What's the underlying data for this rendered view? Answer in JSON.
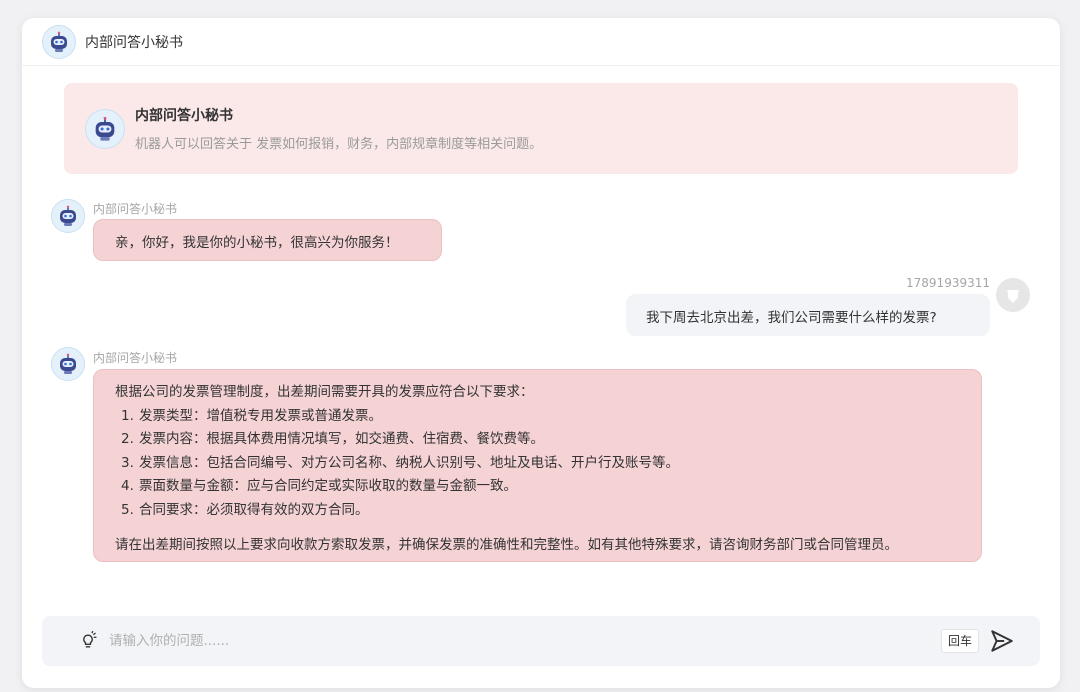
{
  "header": {
    "title": "内部问答小秘书",
    "avatar_icon": "robot-icon"
  },
  "intro": {
    "name": "内部问答小秘书",
    "description": "机器人可以回答关于 发票如何报销，财务，内部规章制度等相关问题。",
    "background": "#fbe9ea"
  },
  "messages": {
    "bot_greeting": {
      "sender": "内部问答小秘书",
      "text": "亲，你好，我是你的小秘书，很高兴为你服务！"
    },
    "user_question": {
      "sender": "17891939311",
      "text": "我下周去北京出差，我们公司需要什么样的发票?"
    },
    "bot_answer": {
      "sender": "内部问答小秘书",
      "intro": "根据公司的发票管理制度，出差期间需要开具的发票应符合以下要求：",
      "items": [
        {
          "num": "1.",
          "text": "发票类型：增值税专用发票或普通发票。"
        },
        {
          "num": "2.",
          "text": "发票内容：根据具体费用情况填写，如交通费、住宿费、餐饮费等。"
        },
        {
          "num": "3.",
          "text": "发票信息：包括合同编号、对方公司名称、纳税人识别号、地址及电话、开户行及账号等。"
        },
        {
          "num": "4.",
          "text": "票面数量与金额：应与合同约定或实际收取的数量与金额一致。"
        },
        {
          "num": "5.",
          "text": "合同要求：必须取得有效的双方合同。"
        }
      ],
      "closing": "请在出差期间按照以上要求向收款方索取发票，并确保发票的准确性和完整性。如有其他特殊要求，请咨询财务部门或合同管理员。"
    }
  },
  "input": {
    "placeholder": "请输入你的问题......",
    "value": "",
    "enter_hint": "回车",
    "bulb_icon": "lightbulb-icon",
    "send_icon": "send-icon"
  },
  "colors": {
    "bot_bubble": "#f5d3d5",
    "user_bubble": "#f3f4f7",
    "window": "#ffffff"
  }
}
